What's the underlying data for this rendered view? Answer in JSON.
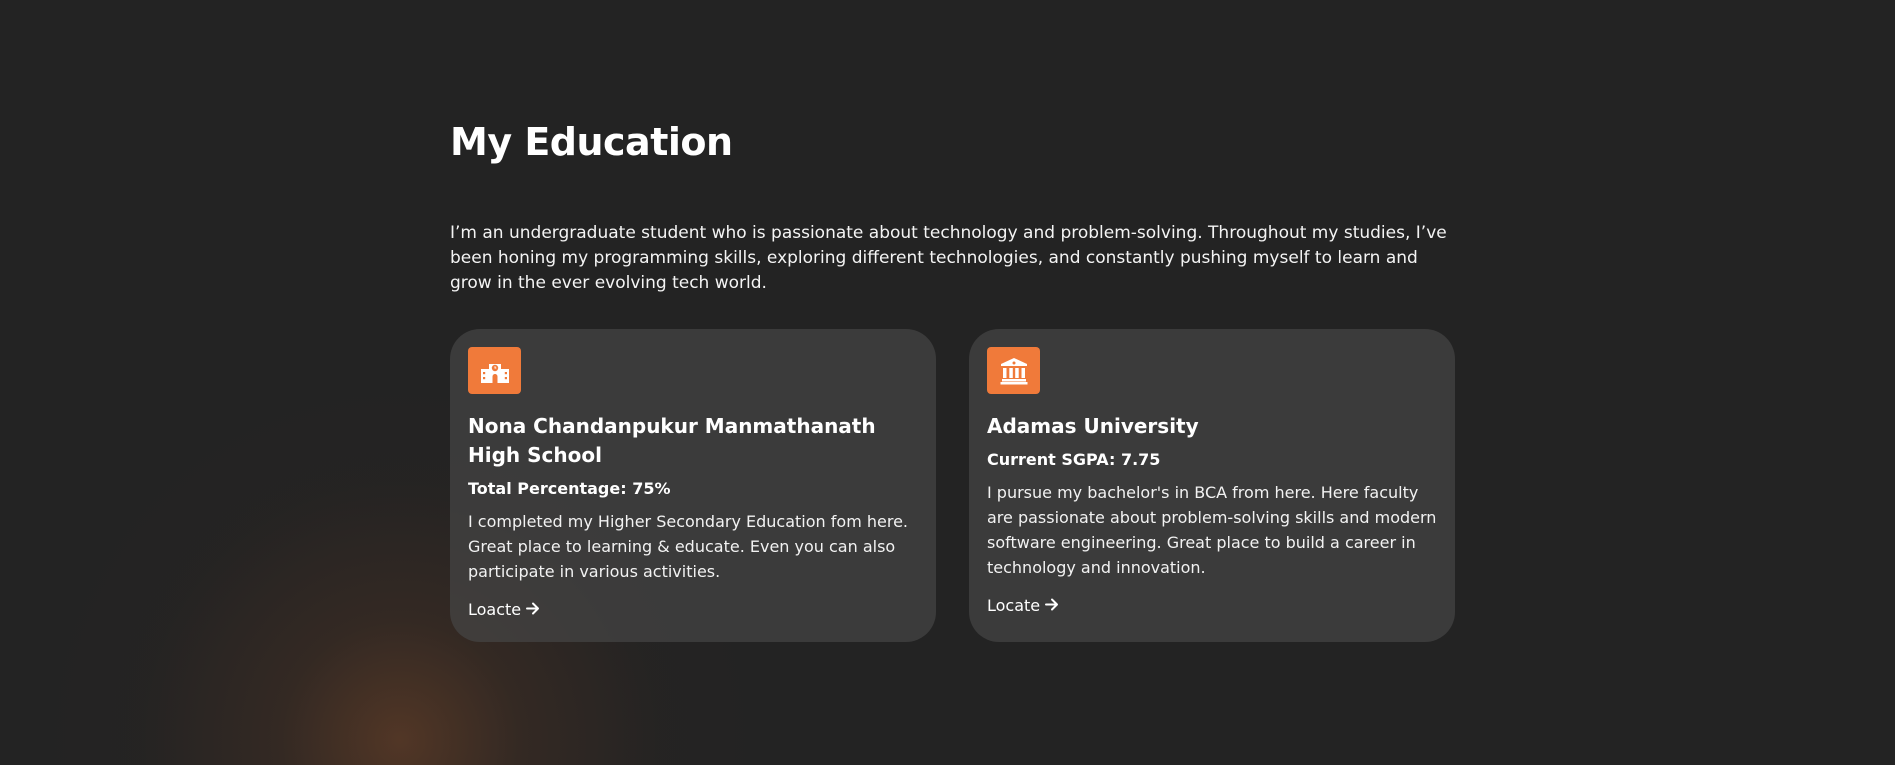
{
  "education": {
    "title": "My Education",
    "intro": "I’m an undergraduate student who is passionate about technology and problem-solving. Throughout my studies, I’ve been honing my programming skills, exploring different technologies, and constantly pushing myself to learn and grow in the ever evolving tech world.",
    "accent_color": "#f07a3a",
    "cards": [
      {
        "icon": "school-icon",
        "title": "Nona Chandanpukur Manmathanath High School",
        "subtitle": "Total Percentage: 75%",
        "description": "I completed my Higher Secondary Education fom here. Great place to learning & educate. Even you can also participate in various activities.",
        "link_label": "Loacte",
        "link_icon": "arrow-right-icon"
      },
      {
        "icon": "university-icon",
        "title": "Adamas University",
        "subtitle": "Current SGPA: 7.75",
        "description": "I pursue my bachelor's in BCA from here. Here faculty are passionate about problem-solving skills and modern software engineering. Great place to build a career in technology and innovation.",
        "link_label": "Locate",
        "link_icon": "arrow-right-icon"
      }
    ]
  }
}
